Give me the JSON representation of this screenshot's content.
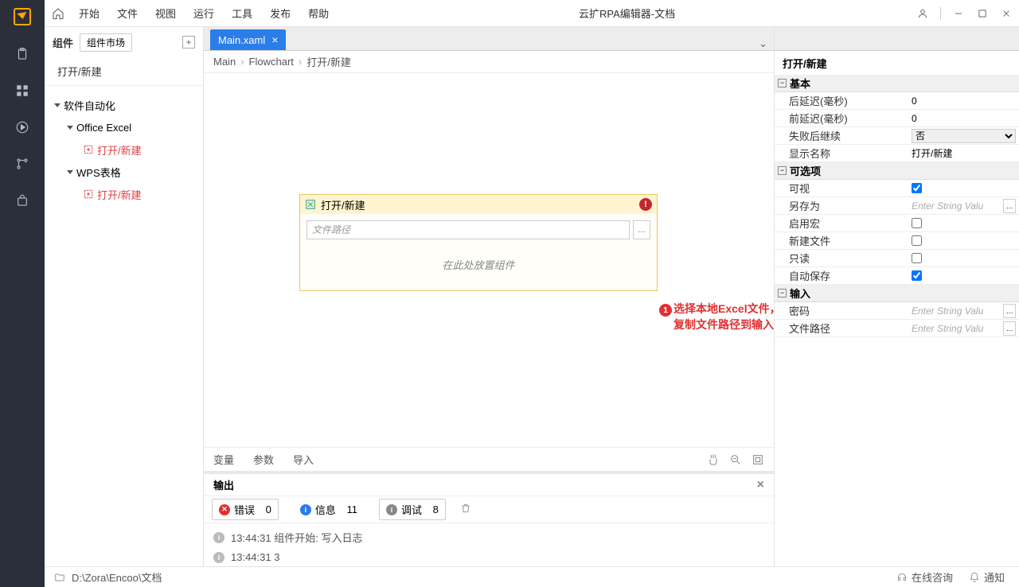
{
  "menubar": {
    "items": [
      "开始",
      "文件",
      "视图",
      "运行",
      "工具",
      "发布",
      "帮助"
    ],
    "title": "云扩RPA编辑器-文档"
  },
  "left": {
    "header": "组件",
    "market": "组件市场",
    "search_value": "打开/新建",
    "tree": [
      {
        "label": "软件自动化",
        "lvl": 0,
        "type": "node"
      },
      {
        "label": "Office Excel",
        "lvl": 1,
        "type": "node"
      },
      {
        "label": "打开/新建",
        "lvl": 2,
        "type": "leaf",
        "red": true
      },
      {
        "label": "WPS表格",
        "lvl": 1,
        "type": "node"
      },
      {
        "label": "打开/新建",
        "lvl": 2,
        "type": "leaf",
        "red": true
      }
    ]
  },
  "tabs": {
    "active": "Main.xaml"
  },
  "crumb": [
    "Main",
    "Flowchart",
    "打开/新建"
  ],
  "activity": {
    "title": "打开/新建",
    "filepath_placeholder": "文件路径",
    "drop_hint": "在此处放置组件"
  },
  "annotation": {
    "num": "1",
    "text": "选择本地Excel文件，或者复制文件路径到输入框"
  },
  "canvas_footer": {
    "vars": "变量",
    "params": "参数",
    "imports": "导入"
  },
  "output": {
    "title": "输出",
    "filters": {
      "error": {
        "label": "错误",
        "count": "0"
      },
      "info": {
        "label": "信息",
        "count": "11"
      },
      "debug": {
        "label": "调试",
        "count": "8"
      }
    },
    "lines": [
      {
        "time": "13:44:31",
        "msg": "组件开始: 写入日志"
      },
      {
        "time": "13:44:31",
        "msg": "3"
      }
    ]
  },
  "props": {
    "title": "打开/新建",
    "groups": [
      {
        "name": "基本",
        "rows": [
          {
            "k": "后延迟(毫秒)",
            "type": "text",
            "v": "0"
          },
          {
            "k": "前延迟(毫秒)",
            "type": "text",
            "v": "0"
          },
          {
            "k": "失败后继续",
            "type": "select",
            "v": "否"
          },
          {
            "k": "显示名称",
            "type": "text",
            "v": "打开/新建"
          }
        ]
      },
      {
        "name": "可选项",
        "rows": [
          {
            "k": "可视",
            "type": "check",
            "v": true
          },
          {
            "k": "另存为",
            "type": "ell",
            "ph": "Enter String Valu"
          },
          {
            "k": "启用宏",
            "type": "check",
            "v": false
          },
          {
            "k": "新建文件",
            "type": "check",
            "v": false
          },
          {
            "k": "只读",
            "type": "check",
            "v": false
          },
          {
            "k": "自动保存",
            "type": "check",
            "v": true
          }
        ]
      },
      {
        "name": "输入",
        "rows": [
          {
            "k": "密码",
            "type": "ell",
            "ph": "Enter String Valu"
          },
          {
            "k": "文件路径",
            "type": "ell",
            "ph": "Enter String Valu"
          }
        ]
      }
    ]
  },
  "status": {
    "path": "D:\\Zora\\Encoo\\文档",
    "consult": "在线咨询",
    "notify": "通知"
  }
}
